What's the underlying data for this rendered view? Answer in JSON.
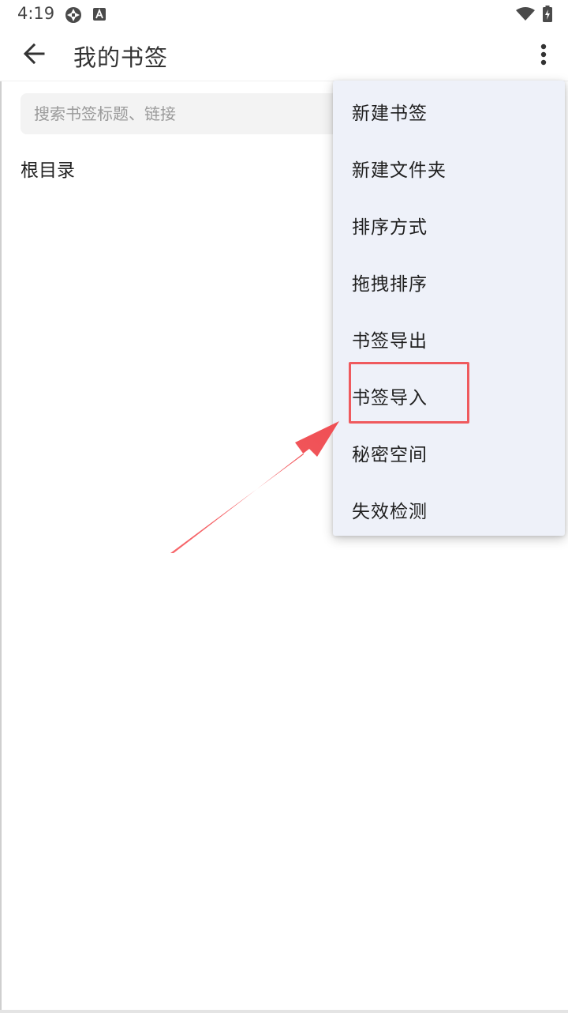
{
  "status_bar": {
    "time": "4:19",
    "icons": [
      "aperture-icon",
      "a-badge-icon",
      "wifi-icon",
      "battery-icon"
    ]
  },
  "app_bar": {
    "title": "我的书签",
    "back_icon": "arrow-left-icon",
    "more_icon": "more-vertical-icon"
  },
  "search": {
    "placeholder": "搜索书签标题、链接",
    "value": ""
  },
  "folder": {
    "label": "根目录"
  },
  "menu": {
    "items": [
      {
        "label": "新建书签"
      },
      {
        "label": "新建文件夹"
      },
      {
        "label": "排序方式"
      },
      {
        "label": "拖拽排序"
      },
      {
        "label": "书签导出"
      },
      {
        "label": "书签导入"
      },
      {
        "label": "秘密空间"
      },
      {
        "label": "失效检测"
      }
    ]
  },
  "annotation": {
    "highlight_color": "#ef5a5e",
    "highlighted_item": "书签导入"
  }
}
